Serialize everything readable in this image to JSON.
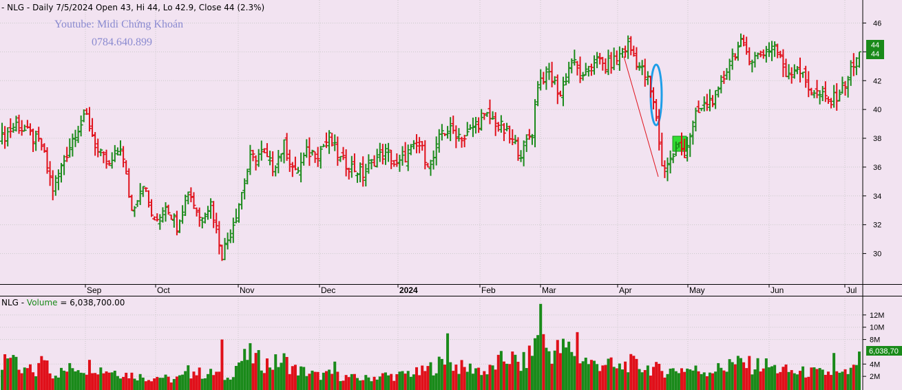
{
  "price_header": {
    "prefix": "- NLG - Daily 7/5/2024 Open 43, Hi 44, Lo 42.9, Close 44 (2.3%)"
  },
  "volume_header": {
    "label": "NLG - ",
    "series_name": "Volume",
    "value_text": " = 6,038,700.00"
  },
  "watermark": {
    "line1": "Youtube: Midi Chứng Khoán",
    "line2": "0784.640.899"
  },
  "price_tags": [
    "44",
    "44"
  ],
  "volume_tag": "6,038,70",
  "colors": {
    "background": "#f2e3f1",
    "up": "#1a8a1a",
    "down": "#e0101a",
    "ellipse": "#1e9ee8",
    "highlight": "#33dd33",
    "grid": "#c9c9c9"
  },
  "chart_data": {
    "type": "ohlc-bar",
    "x_labels": [
      "Sep",
      "Oct",
      "Nov",
      "Dec",
      "2024",
      "Feb",
      "Mar",
      "Apr",
      "May",
      "Jun",
      "Jul"
    ],
    "price_axis": {
      "ticks": [
        30,
        32,
        34,
        36,
        38,
        40,
        42,
        44,
        46
      ],
      "range": [
        28.5,
        46.5
      ]
    },
    "volume_axis": {
      "ticks": [
        "2M",
        "4M",
        "8M",
        "10M",
        "12M"
      ],
      "tick_values": [
        2,
        4,
        8,
        10,
        12
      ],
      "range": [
        0,
        14
      ],
      "unit": "million shares"
    },
    "close_anchors": [
      [
        0,
        38.0
      ],
      [
        5,
        39.0
      ],
      [
        10,
        38.2
      ],
      [
        14,
        37.5
      ],
      [
        18,
        34.5
      ],
      [
        22,
        36.5
      ],
      [
        26,
        38.5
      ],
      [
        30,
        39.5
      ],
      [
        34,
        37.0
      ],
      [
        38,
        36.0
      ],
      [
        42,
        37.5
      ],
      [
        46,
        33.0
      ],
      [
        50,
        35.0
      ],
      [
        54,
        32.0
      ],
      [
        58,
        33.5
      ],
      [
        62,
        32.0
      ],
      [
        66,
        34.5
      ],
      [
        70,
        32.5
      ],
      [
        74,
        33.5
      ],
      [
        78,
        30.0
      ],
      [
        81,
        31.5
      ],
      [
        84,
        33.5
      ],
      [
        88,
        36.5
      ],
      [
        92,
        37.0
      ],
      [
        96,
        36.0
      ],
      [
        100,
        37.5
      ],
      [
        104,
        35.5
      ],
      [
        108,
        37.0
      ],
      [
        112,
        37.0
      ],
      [
        116,
        38.0
      ],
      [
        120,
        36.5
      ],
      [
        124,
        36.0
      ],
      [
        128,
        35.5
      ],
      [
        132,
        36.5
      ],
      [
        136,
        37.0
      ],
      [
        140,
        36.0
      ],
      [
        144,
        37.0
      ],
      [
        148,
        37.5
      ],
      [
        152,
        36.0
      ],
      [
        156,
        38.5
      ],
      [
        160,
        38.5
      ],
      [
        164,
        38.0
      ],
      [
        168,
        39.0
      ],
      [
        172,
        39.5
      ],
      [
        176,
        39.0
      ],
      [
        180,
        38.0
      ],
      [
        184,
        37.0
      ],
      [
        188,
        38.5
      ],
      [
        190,
        42.0
      ],
      [
        194,
        42.5
      ],
      [
        198,
        41.0
      ],
      [
        202,
        43.5
      ],
      [
        206,
        42.0
      ],
      [
        210,
        43.5
      ],
      [
        214,
        43.0
      ],
      [
        218,
        43.5
      ],
      [
        222,
        44.5
      ],
      [
        226,
        43.0
      ],
      [
        229,
        42.0
      ],
      [
        232,
        39.5
      ],
      [
        234,
        36.0
      ],
      [
        237,
        36.5
      ],
      [
        240,
        37.5
      ],
      [
        242,
        37.0
      ],
      [
        246,
        39.5
      ],
      [
        250,
        40.5
      ],
      [
        254,
        41.0
      ],
      [
        258,
        43.5
      ],
      [
        262,
        44.5
      ],
      [
        266,
        43.5
      ],
      [
        270,
        44.0
      ],
      [
        274,
        44.5
      ],
      [
        278,
        42.5
      ],
      [
        282,
        43.0
      ],
      [
        286,
        41.5
      ],
      [
        290,
        41.0
      ],
      [
        294,
        40.5
      ],
      [
        298,
        41.5
      ],
      [
        302,
        43.0
      ],
      [
        304,
        44.0
      ]
    ],
    "volume_anchors": [
      [
        0,
        2.6
      ],
      [
        3,
        6.6
      ],
      [
        6,
        2.3
      ],
      [
        9,
        3.1
      ],
      [
        12,
        2.6
      ],
      [
        15,
        5.6
      ],
      [
        18,
        2.4
      ],
      [
        22,
        2.8
      ],
      [
        26,
        3.6
      ],
      [
        30,
        3.4
      ],
      [
        32,
        4.1
      ],
      [
        35,
        3.2
      ],
      [
        40,
        2.9
      ],
      [
        44,
        2.4
      ],
      [
        48,
        2.1
      ],
      [
        52,
        1.7
      ],
      [
        56,
        2.0
      ],
      [
        60,
        1.4
      ],
      [
        64,
        1.9
      ],
      [
        68,
        2.8
      ],
      [
        72,
        2.3
      ],
      [
        76,
        2.6
      ],
      [
        80,
        1.6
      ],
      [
        84,
        4.4
      ],
      [
        88,
        5.3
      ],
      [
        92,
        4.3
      ],
      [
        96,
        4.0
      ],
      [
        100,
        4.6
      ],
      [
        104,
        3.1
      ],
      [
        108,
        2.7
      ],
      [
        112,
        2.1
      ],
      [
        116,
        2.3
      ],
      [
        120,
        2.0
      ],
      [
        124,
        1.8
      ],
      [
        128,
        1.6
      ],
      [
        132,
        1.9
      ],
      [
        136,
        2.2
      ],
      [
        140,
        2.0
      ],
      [
        144,
        2.6
      ],
      [
        148,
        2.5
      ],
      [
        152,
        3.4
      ],
      [
        156,
        4.1
      ],
      [
        160,
        3.9
      ],
      [
        164,
        3.2
      ],
      [
        168,
        3.4
      ],
      [
        172,
        2.6
      ],
      [
        176,
        4.2
      ],
      [
        180,
        5.2
      ],
      [
        184,
        3.7
      ],
      [
        188,
        6.0
      ],
      [
        190,
        8.8
      ],
      [
        194,
        6.1
      ],
      [
        198,
        6.3
      ],
      [
        202,
        6.5
      ],
      [
        206,
        4.8
      ],
      [
        210,
        3.9
      ],
      [
        214,
        4.4
      ],
      [
        218,
        3.1
      ],
      [
        222,
        4.2
      ],
      [
        226,
        3.6
      ],
      [
        230,
        3.4
      ],
      [
        234,
        2.9
      ],
      [
        238,
        3.0
      ],
      [
        242,
        3.3
      ],
      [
        246,
        3.0
      ],
      [
        250,
        2.9
      ],
      [
        254,
        3.2
      ],
      [
        258,
        3.6
      ],
      [
        262,
        4.2
      ],
      [
        266,
        3.7
      ],
      [
        270,
        3.9
      ],
      [
        274,
        3.3
      ],
      [
        278,
        2.9
      ],
      [
        282,
        2.6
      ],
      [
        286,
        2.7
      ],
      [
        290,
        2.5
      ],
      [
        294,
        2.6
      ],
      [
        298,
        2.2
      ],
      [
        302,
        3.0
      ],
      [
        304,
        6.04
      ]
    ],
    "volume_spikes": [
      [
        1,
        5.6
      ],
      [
        14,
        5.3
      ],
      [
        66,
        3.8
      ],
      [
        78,
        8.0
      ],
      [
        118,
        4.4
      ],
      [
        158,
        9.0
      ],
      [
        189,
        8.2
      ],
      [
        191,
        13.8
      ],
      [
        204,
        9.2
      ],
      [
        258,
        4.8
      ],
      [
        295,
        5.8
      ]
    ],
    "last_bar": {
      "date": "7/5/2024",
      "open": 43,
      "high": 44,
      "low": 42.9,
      "close": 44,
      "change_pct": 2.3,
      "volume": 6038700
    }
  }
}
